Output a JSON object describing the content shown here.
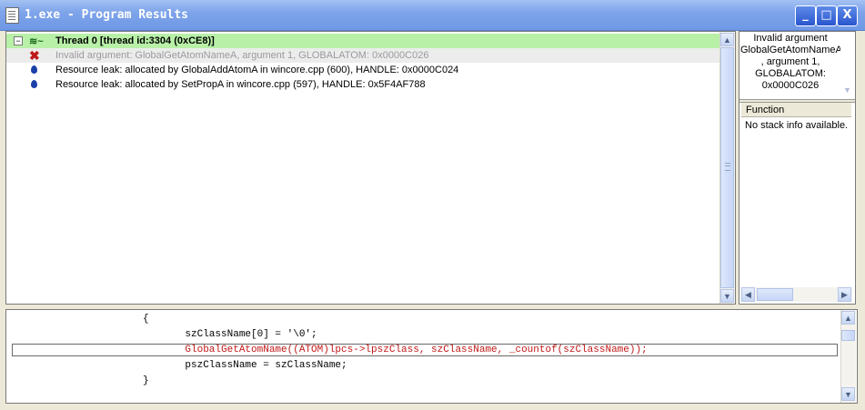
{
  "window": {
    "title": "1.exe - Program Results",
    "controls": {
      "minimize": "_",
      "maximize": "□",
      "close": "X"
    }
  },
  "results": {
    "thread": {
      "expander": "−",
      "label": "Thread 0 [thread id:3304 (0xCE8)]"
    },
    "items": [
      {
        "icon": "error-x-icon",
        "text": "Invalid argument: GlobalGetAtomNameA, argument 1, GLOBALATOM: 0x0000C026"
      },
      {
        "icon": "leak-drop-icon",
        "text": "Resource leak: allocated by GlobalAddAtomA in wincore.cpp (600), HANDLE: 0x0000C024"
      },
      {
        "icon": "leak-drop-icon",
        "text": "Resource leak: allocated by SetPropA in wincore.cpp (597), HANDLE: 0x5F4AF788"
      }
    ]
  },
  "detail": {
    "lines": [
      "Invalid argument",
      "GlobalGetAtomNameA",
      ", argument 1,",
      "GLOBALATOM:",
      "0x0000C026"
    ]
  },
  "function_panel": {
    "header": "Function",
    "body": "No stack info available."
  },
  "code": {
    "lines": [
      "{",
      "    szClassName[0] = '\\0';",
      "    GlobalGetAtomName((ATOM)lpcs->lpszClass, szClassName, _countof(szClassName));",
      "    pszClassName = szClassName;",
      "}"
    ],
    "highlight_index": 2
  },
  "colors": {
    "title_bar": "#7ea4ea",
    "thread_row": "#b8f0a8",
    "error": "#c01818",
    "leak": "#1a3fa8"
  }
}
